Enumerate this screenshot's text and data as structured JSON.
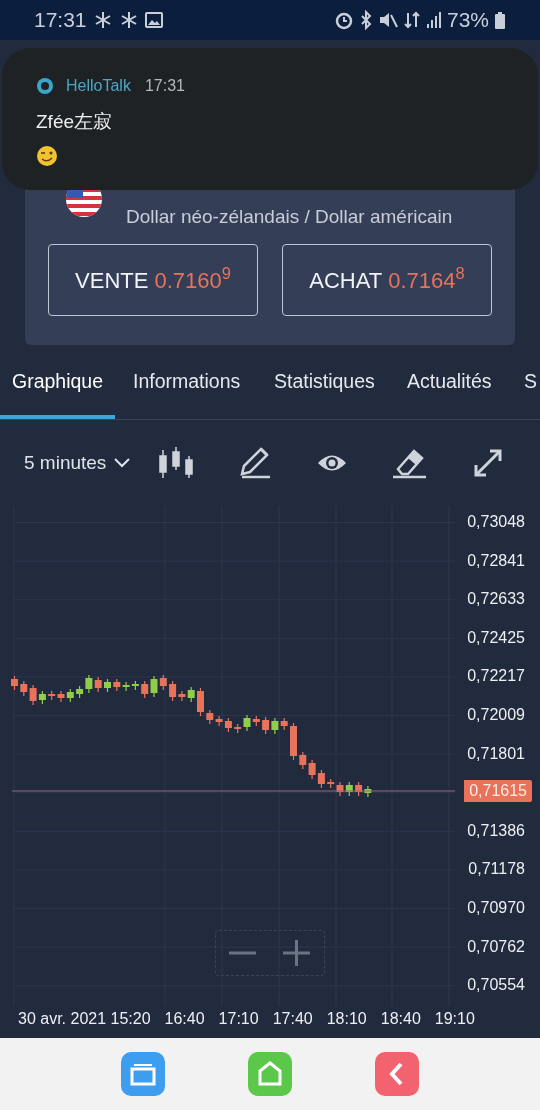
{
  "status_bar": {
    "time": "17:31",
    "battery": "73%"
  },
  "notification": {
    "app": "HelloTalk",
    "time": "17:31",
    "sender": "Zfée左寂"
  },
  "instrument": {
    "name": "Dollar néo-zélandais / Dollar américain"
  },
  "quote_buttons": [
    {
      "label": "VENTE",
      "price": "0.7160$^{9}$"
    },
    {
      "label": "ACHAT",
      "price": "0.7164$^{8}$"
    }
  ],
  "tabs": [
    {
      "label": "Graphique",
      "selected": true
    },
    {
      "label": "Informations",
      "selected": false
    },
    {
      "label": "Statistiques",
      "selected": false
    },
    {
      "label": "Actualités",
      "selected": false
    },
    {
      "label": "S",
      "selected": false
    }
  ],
  "toolbar": {
    "interval": "5 minutes"
  },
  "chart": {
    "y_labels": [
      "0,73048",
      "0,72841",
      "0,72633",
      "0,72425",
      "0,72217",
      "0,72009",
      "0,71801",
      "0,71386",
      "0,71178",
      "0,70970",
      "0,70762",
      "0,70554"
    ],
    "current_price": "0,71615",
    "x_labels": [
      "30 avr. 2021 15:20",
      "16:40",
      "17:10",
      "17:40",
      "18:10",
      "18:40",
      "19:10"
    ]
  }
}
